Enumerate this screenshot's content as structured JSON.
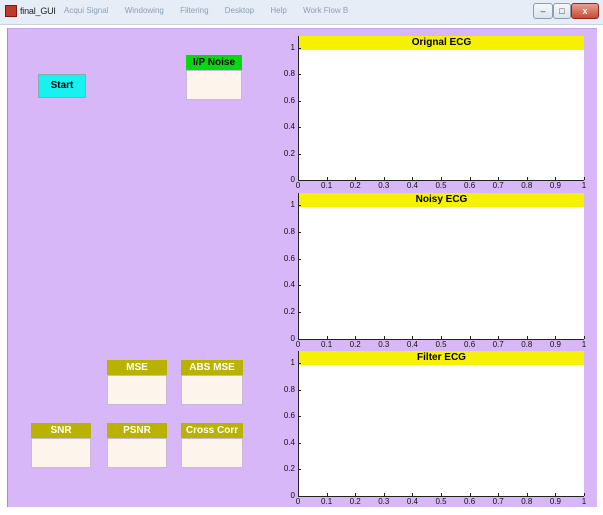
{
  "window": {
    "title": "final_GUI",
    "menu": [
      "Acqui Signal",
      "Windowing",
      "Filtering",
      "Desktop",
      "Help",
      "Work Flow B"
    ],
    "buttons": {
      "minimize": "–",
      "maximize": "□",
      "close": "x"
    }
  },
  "controls": {
    "start_label": "Start",
    "ip_noise_label": "I/P Noise",
    "mse_label": "MSE",
    "abs_mse_label": "ABS MSE",
    "snr_label": "SNR",
    "psnr_label": "PSNR",
    "cross_corr_label": "Cross Corr"
  },
  "colors": {
    "background": "#d8b7f8",
    "start_button": "#19f0f0",
    "ip_noise_header": "#09d80e",
    "metric_header": "#bab200",
    "plot_title_bar": "#f5f100"
  },
  "axis_ticks": {
    "y": [
      "0",
      "0.2",
      "0.4",
      "0.6",
      "0.8",
      "1"
    ],
    "x": [
      "0",
      "0.1",
      "0.2",
      "0.3",
      "0.4",
      "0.5",
      "0.6",
      "0.7",
      "0.8",
      "0.9",
      "1"
    ]
  },
  "chart_data": [
    {
      "type": "line",
      "title": "Orignal ECG",
      "xlim": [
        0,
        1
      ],
      "ylim": [
        0,
        1
      ],
      "series": []
    },
    {
      "type": "line",
      "title": "Noisy ECG",
      "xlim": [
        0,
        1
      ],
      "ylim": [
        0,
        1
      ],
      "series": []
    },
    {
      "type": "line",
      "title": "Filter ECG",
      "xlim": [
        0,
        1
      ],
      "ylim": [
        0,
        1
      ],
      "series": []
    }
  ]
}
